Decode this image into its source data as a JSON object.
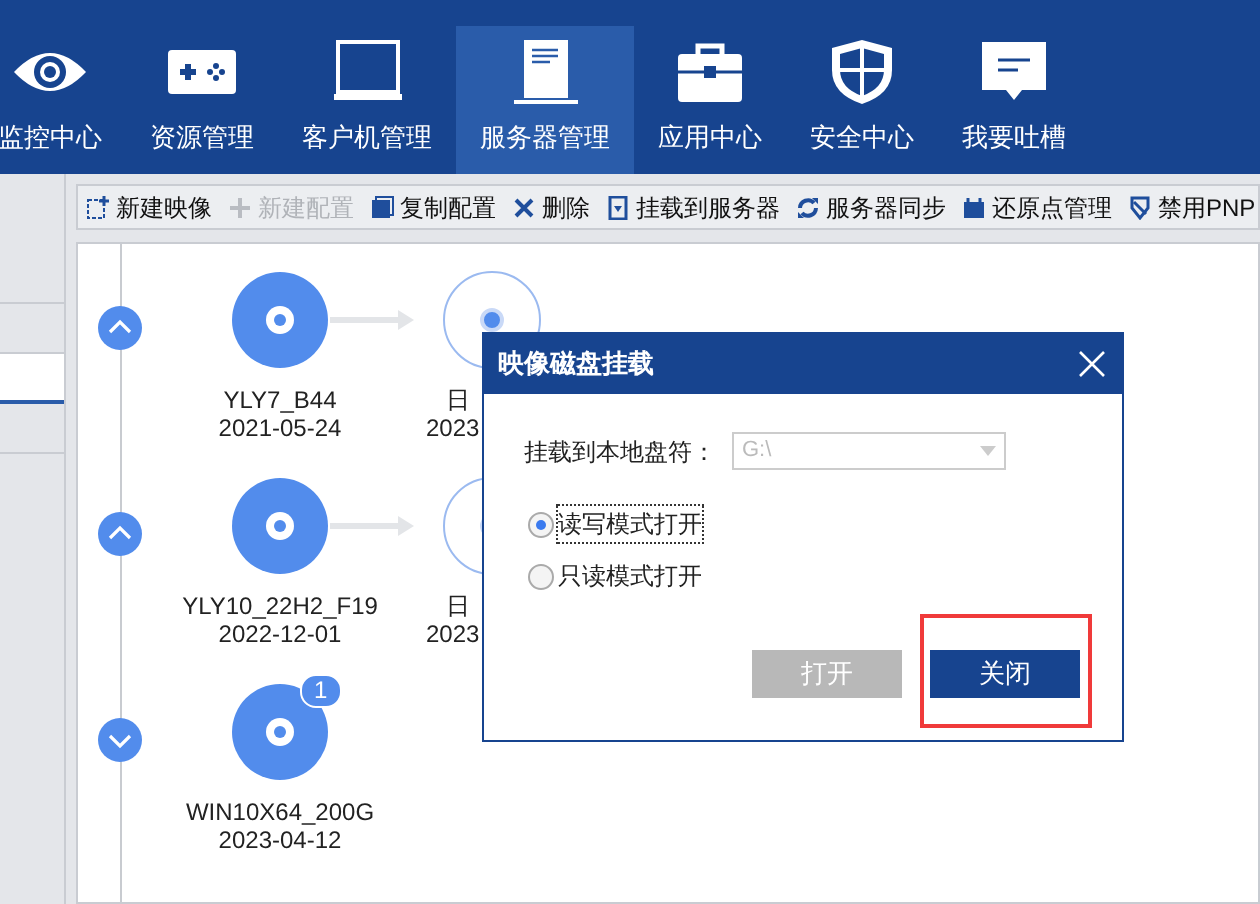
{
  "nav": [
    {
      "label": "监控中心",
      "selected": false
    },
    {
      "label": "资源管理",
      "selected": false
    },
    {
      "label": "客户机管理",
      "selected": false
    },
    {
      "label": "服务器管理",
      "selected": true
    },
    {
      "label": "应用中心",
      "selected": false
    },
    {
      "label": "安全中心",
      "selected": false
    },
    {
      "label": "我要吐槽",
      "selected": false
    }
  ],
  "sidebar": {
    "items": [
      {
        "selected": false
      },
      {
        "selected": false
      },
      {
        "selected": true
      },
      {
        "selected": false
      }
    ]
  },
  "toolbar": [
    {
      "label": "新建映像",
      "disabled": false
    },
    {
      "label": "新建配置",
      "disabled": true
    },
    {
      "label": "复制配置",
      "disabled": false
    },
    {
      "label": "删除",
      "disabled": false
    },
    {
      "label": "挂载到服务器",
      "disabled": false
    },
    {
      "label": "服务器同步",
      "disabled": false
    },
    {
      "label": "还原点管理",
      "disabled": false
    },
    {
      "label": "禁用PNP",
      "disabled": false
    }
  ],
  "images": [
    {
      "name": "YLY7_B44",
      "date": "2021-05-24",
      "expanded": true,
      "children": [
        {
          "name": "日",
          "date": "2023"
        }
      ]
    },
    {
      "name": "YLY10_22H2_F19",
      "date": "2022-12-01",
      "expanded": true,
      "children": [
        {
          "name": "日",
          "date": "2023"
        }
      ]
    },
    {
      "name": "WIN10X64_200G",
      "date": "2023-04-12",
      "expanded": false,
      "badge": "1"
    }
  ],
  "dialog": {
    "title": "映像磁盘挂载",
    "drive_label": "挂载到本地盘符：",
    "drive_value": "G:\\",
    "drive_disabled": true,
    "options": [
      {
        "label": "读写模式打开",
        "selected": true
      },
      {
        "label": "只读模式打开",
        "selected": false
      }
    ],
    "buttons": [
      {
        "label": "打开",
        "disabled": true,
        "highlighted": false
      },
      {
        "label": "关闭",
        "disabled": false,
        "highlighted": true
      }
    ]
  }
}
